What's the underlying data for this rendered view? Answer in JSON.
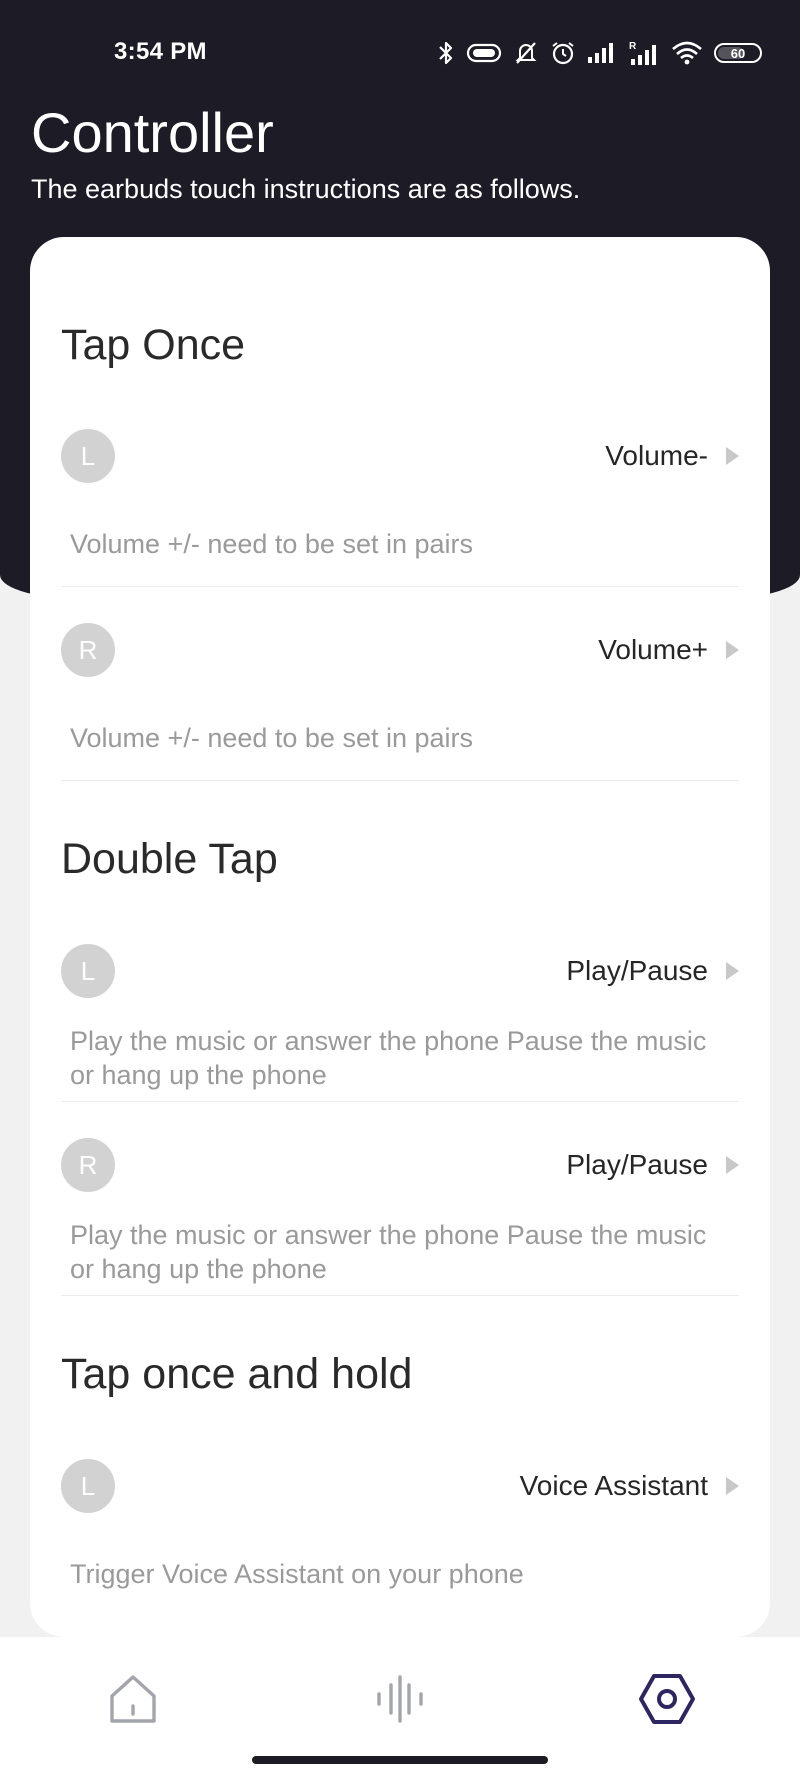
{
  "status_bar": {
    "time": "3:54 PM",
    "battery": "60"
  },
  "header": {
    "title": "Controller",
    "subtitle": "The earbuds touch instructions are as follows."
  },
  "sections": [
    {
      "title": "Tap Once",
      "rows": [
        {
          "side": "L",
          "action": "Volume-",
          "description": "Volume +/- need to be set in pairs"
        },
        {
          "side": "R",
          "action": "Volume+",
          "description": "Volume +/- need to be set in pairs"
        }
      ]
    },
    {
      "title": "Double Tap",
      "rows": [
        {
          "side": "L",
          "action": "Play/Pause",
          "description": "Play the music or answer the phone Pause the music or hang up the phone"
        },
        {
          "side": "R",
          "action": "Play/Pause",
          "description": "Play the music or answer the phone Pause the music or hang up the phone"
        }
      ]
    },
    {
      "title": "Tap once and hold",
      "rows": [
        {
          "side": "L",
          "action": "Voice Assistant",
          "description": "Trigger Voice Assistant on your phone"
        }
      ]
    }
  ],
  "nav": {
    "items": [
      {
        "icon": "home-icon",
        "active": false
      },
      {
        "icon": "equalizer-icon",
        "active": false
      },
      {
        "icon": "settings-hexagon-icon",
        "active": true
      }
    ],
    "active_color": "#2d2660",
    "inactive_color": "#a4a4ad"
  },
  "colors": {
    "header_bg": "#1c1b26",
    "page_bg": "#f1f1f2",
    "badge_bg": "#d2d2d2",
    "desc_text": "#9a9a9a"
  }
}
